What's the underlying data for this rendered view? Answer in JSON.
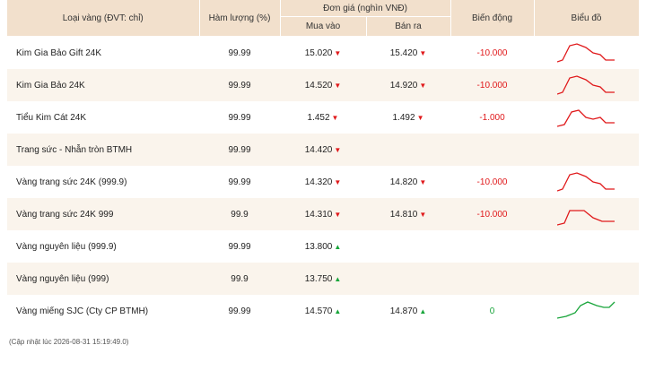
{
  "headers": {
    "type": "Loại vàng (ĐVT: chỉ)",
    "purity": "Hàm lượng (%)",
    "price_group": "Đơn giá (nghìn VNĐ)",
    "buy": "Mua vào",
    "sell": "Bán ra",
    "change": "Biến động",
    "chart": "Biểu đồ"
  },
  "colors": {
    "header_bg": "#f2e0cc",
    "stripe_bg": "#faf4ec",
    "down": "#e0191b",
    "up": "#18a53a"
  },
  "rows": [
    {
      "name": "Kim Gia Bảo Gift 24K",
      "purity": "99.99",
      "buy": "15.020",
      "buy_dir": "down",
      "sell": "15.420",
      "sell_dir": "down",
      "change": "-10.000",
      "trend": "down-hump"
    },
    {
      "name": "Kim Gia Bảo 24K",
      "purity": "99.99",
      "buy": "14.520",
      "buy_dir": "down",
      "sell": "14.920",
      "sell_dir": "down",
      "change": "-10.000",
      "trend": "down-hump"
    },
    {
      "name": "Tiểu Kim Cát 24K",
      "purity": "99.99",
      "buy": "1.452",
      "buy_dir": "down",
      "sell": "1.492",
      "sell_dir": "down",
      "change": "-1.000",
      "trend": "down-step"
    },
    {
      "name": "Trang sức - Nhẫn tròn BTMH",
      "purity": "99.99",
      "buy": "14.420",
      "buy_dir": "down",
      "sell": "",
      "sell_dir": "",
      "change": "",
      "trend": ""
    },
    {
      "name": "Vàng trang sức 24K (999.9)",
      "purity": "99.99",
      "buy": "14.320",
      "buy_dir": "down",
      "sell": "14.820",
      "sell_dir": "down",
      "change": "-10.000",
      "trend": "down-hump"
    },
    {
      "name": "Vàng trang sức 24K 999",
      "purity": "99.9",
      "buy": "14.310",
      "buy_dir": "down",
      "sell": "14.810",
      "sell_dir": "down",
      "change": "-10.000",
      "trend": "down-plateau"
    },
    {
      "name": "Vàng nguyên liệu (999.9)",
      "purity": "99.99",
      "buy": "13.800",
      "buy_dir": "up",
      "sell": "",
      "sell_dir": "",
      "change": "",
      "trend": ""
    },
    {
      "name": "Vàng nguyên liệu (999)",
      "purity": "99.9",
      "buy": "13.750",
      "buy_dir": "up",
      "sell": "",
      "sell_dir": "",
      "change": "",
      "trend": ""
    },
    {
      "name": "Vàng miếng SJC (Cty CP BTMH)",
      "purity": "99.99",
      "buy": "14.570",
      "buy_dir": "up",
      "sell": "14.870",
      "sell_dir": "up",
      "change": "0",
      "trend": "up"
    }
  ],
  "footer": "(Cập nhật lúc 2026-08-31 15:19:49.0)"
}
